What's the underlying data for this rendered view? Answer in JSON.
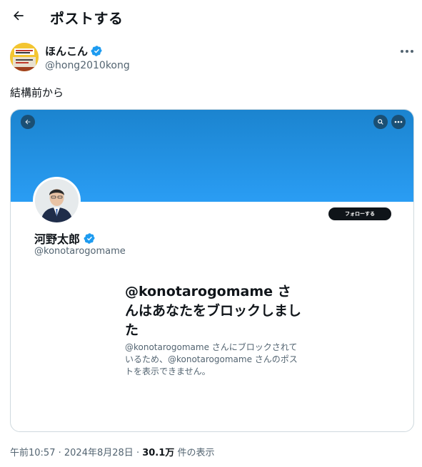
{
  "header": {
    "title": "ポストする"
  },
  "author": {
    "name": "ほんこん",
    "handle": "@hong2010kong"
  },
  "tweet": {
    "text": "結構前から"
  },
  "embedded": {
    "profile_name": "河野太郎",
    "profile_handle": "@konotarogomame",
    "follow_label": "フォローする",
    "block_title": "@konotarogomame さんはあなたをブロックしました",
    "block_desc": "@konotarogomame さんにブロックされているため、@konotarogomame さんのポストを表示できません。"
  },
  "meta": {
    "time": "午前10:57",
    "date": "2024年8月28日",
    "separator": "·",
    "views": "30.1万",
    "views_label": "件の表示"
  },
  "colors": {
    "verified": "#1d9bf0",
    "banner": "#2a9df4",
    "muted": "#536471"
  }
}
